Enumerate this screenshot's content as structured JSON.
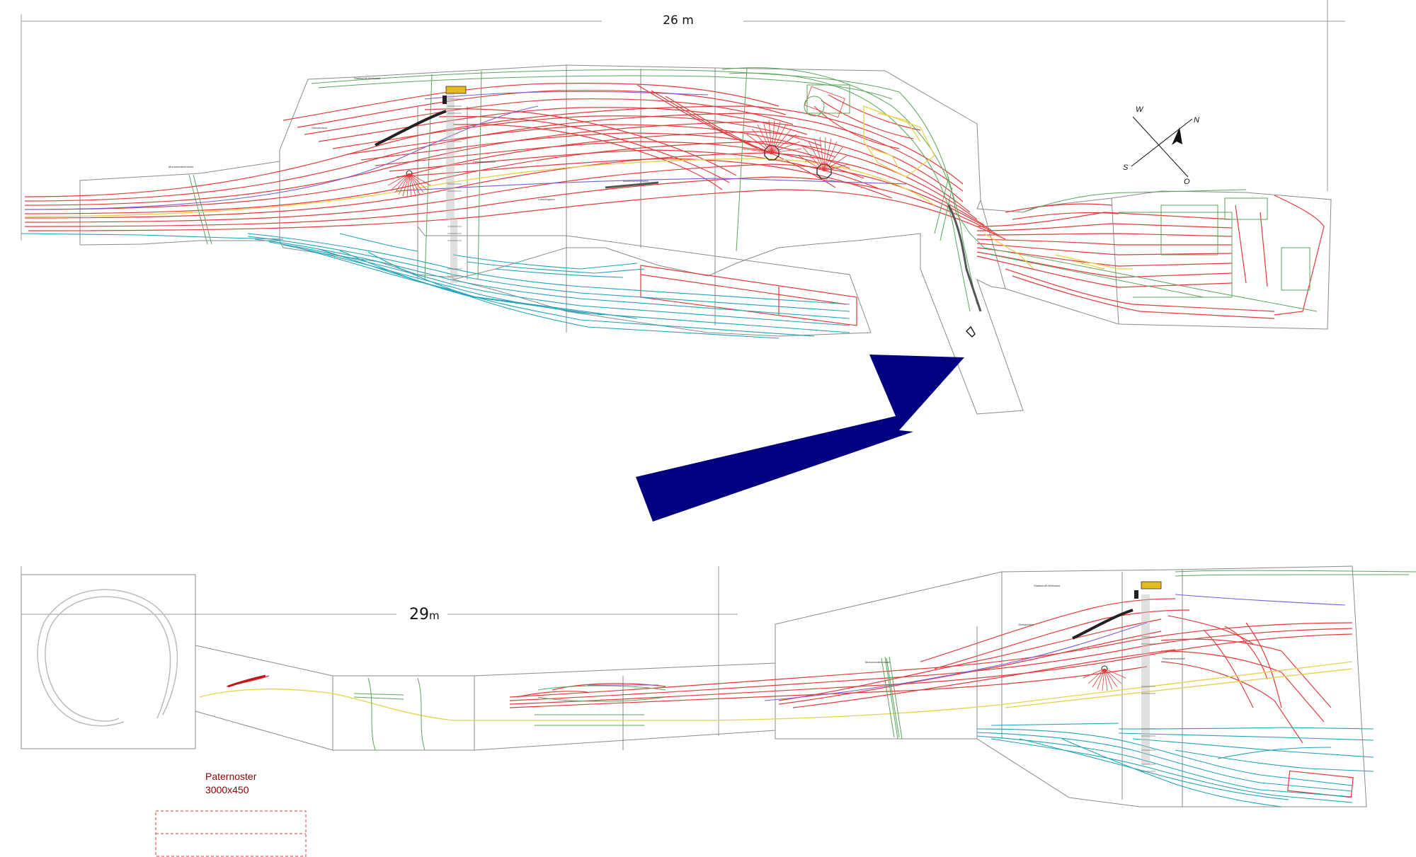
{
  "top_plan": {
    "dimension_label": "26 m",
    "bridge_label": "Monumentenbrücke",
    "small_labels": [
      "Stadtschiff-Werkstatt",
      "Gleisdreieck",
      "Personenbahnhof",
      "Ausbesserungswerk",
      "Lokschuppen"
    ]
  },
  "bottom_plan": {
    "dimension_value": "29",
    "dimension_unit": "m",
    "bridge_label": "Monumentenbrücke",
    "small_labels": [
      "Stadtschiff-Werkstatt",
      "Gleisdreieck",
      "Personenbahnhof"
    ]
  },
  "compass": {
    "west": "W",
    "north": "N",
    "south": "S",
    "east": "O"
  },
  "paternoster": {
    "title": "Paternoster",
    "size": "3000x450"
  },
  "colors": {
    "track_red": "#e23b3b",
    "track_cyan": "#1fa3b8",
    "track_green": "#5aa55a",
    "track_yellow": "#e5d24a",
    "track_purple": "#7a5cd6",
    "arrow_navy": "#000080",
    "outline_grey": "#8a8a8a"
  }
}
